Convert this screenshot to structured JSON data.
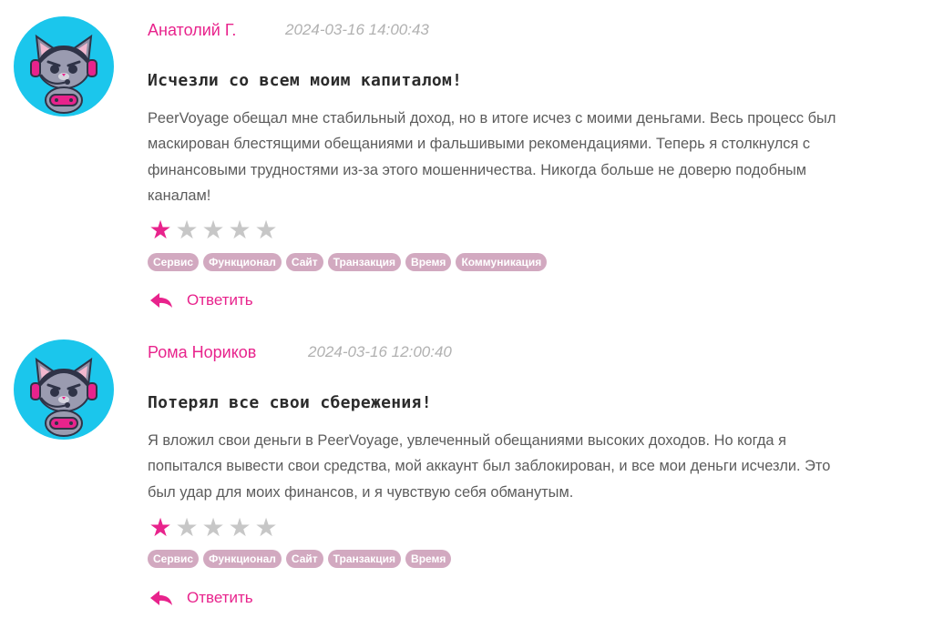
{
  "colors": {
    "accent": "#e8238c",
    "tag_bg": "#d2a9c0",
    "star_off": "#c7c7c7",
    "avatar_bg": "#1bc6ec"
  },
  "reviews": [
    {
      "author": "Анатолий Г.",
      "date": "2024-03-16 14:00:43",
      "title": "Исчезли со всем моим капиталом!",
      "body_lines": [
        "PeerVoyage обещал мне стабильный доход, но в итоге исчез с моими деньгами. Весь процесс был",
        "маскирован блестящими обещаниями и фальшивыми рекомендациями. Теперь я столкнулся с",
        "финансовыми трудностями из-за этого мошенничества. Никогда больше не доверю подобным",
        "каналам!"
      ],
      "rating": 1,
      "rating_max": 5,
      "tags": [
        "Сервис",
        "Функционал",
        "Сайт",
        "Транзакция",
        "Время",
        "Коммуникация"
      ],
      "reply_label": "Ответить",
      "avatar_icon": "gamer-cat-avatar"
    },
    {
      "author": "Рома Нориков",
      "date": "2024-03-16 12:00:40",
      "title": "Потерял все свои сбережения!",
      "body_lines": [
        "Я вложил свои деньги в PeerVoyage, увлеченный обещаниями высоких доходов. Но когда я",
        "попытался вывести свои средства, мой аккаунт был заблокирован, и все мои деньги исчезли. Это",
        "был удар для моих финансов, и я чувствую себя обманутым."
      ],
      "rating": 1,
      "rating_max": 5,
      "tags": [
        "Сервис",
        "Функционал",
        "Сайт",
        "Транзакция",
        "Время"
      ],
      "reply_label": "Ответить",
      "avatar_icon": "gamer-cat-avatar"
    }
  ]
}
